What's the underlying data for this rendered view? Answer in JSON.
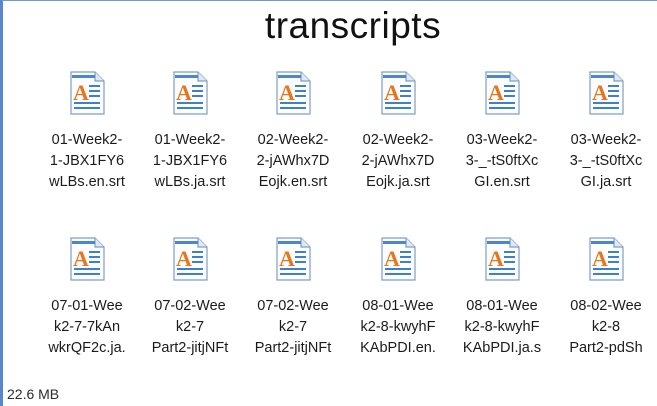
{
  "window": {
    "title": "transcripts"
  },
  "files": [
    {
      "name": "01-Week2-\n1-JBX1FY6\nwLBs.en.srt",
      "icon": "text-document-icon"
    },
    {
      "name": "01-Week2-\n1-JBX1FY6\nwLBs.ja.srt",
      "icon": "text-document-icon"
    },
    {
      "name": "02-Week2-\n2-jAWhx7D\nEojk.en.srt",
      "icon": "text-document-icon"
    },
    {
      "name": "02-Week2-\n2-jAWhx7D\nEojk.ja.srt",
      "icon": "text-document-icon"
    },
    {
      "name": "03-Week2-\n3-_-tS0ftXc\nGI.en.srt",
      "icon": "text-document-icon"
    },
    {
      "name": "03-Week2-\n3-_-tS0ftXc\nGI.ja.srt",
      "icon": "text-document-icon"
    },
    {
      "name": "07-01-Wee\nk2-7-7kAn\nwkrQF2c.ja.",
      "icon": "text-document-icon"
    },
    {
      "name": "07-02-Wee\nk2-7\nPart2-jitjNFt",
      "icon": "text-document-icon"
    },
    {
      "name": "07-02-Wee\nk2-7\nPart2-jitjNFt",
      "icon": "text-document-icon"
    },
    {
      "name": "08-01-Wee\nk2-8-kwyhF\nKAbPDI.en.",
      "icon": "text-document-icon"
    },
    {
      "name": "08-01-Wee\nk2-8-kwyhF\nKAbPDI.ja.s",
      "icon": "text-document-icon"
    },
    {
      "name": "08-02-Wee\nk2-8\nPart2-pdSh",
      "icon": "text-document-icon"
    }
  ],
  "status_bar": {
    "size": "22.6 MB"
  },
  "colors": {
    "window_border": "#5b87c9",
    "icon_letter": "#e8761c",
    "icon_lines": "#3f7fd0"
  }
}
